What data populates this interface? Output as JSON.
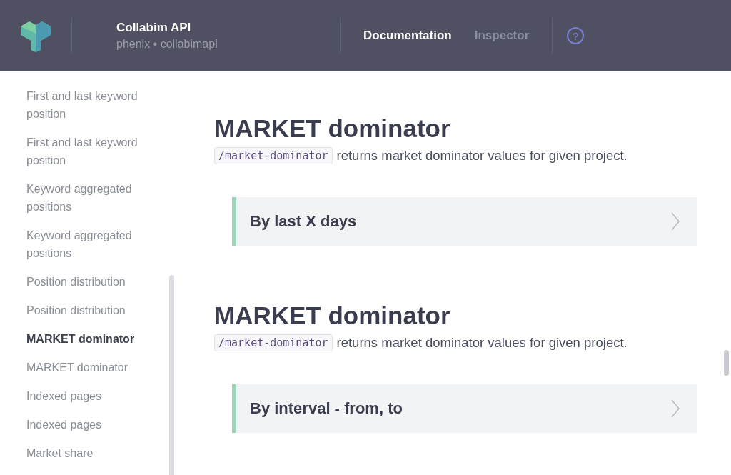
{
  "header": {
    "title": "Collabim API",
    "subtitle": "phenix • collabimapi",
    "nav": [
      {
        "label": "Documentation",
        "selected": true
      },
      {
        "label": "Inspector",
        "selected": false
      }
    ],
    "help": "?"
  },
  "sidebar": {
    "items": [
      {
        "label": "First and last keyword position",
        "selected": false
      },
      {
        "label": "First and last keyword position",
        "selected": false
      },
      {
        "label": "Keyword aggregated positions",
        "selected": false
      },
      {
        "label": "Keyword aggregated positions",
        "selected": false
      },
      {
        "label": "Position distribution",
        "selected": false
      },
      {
        "label": "Position distribution",
        "selected": false
      },
      {
        "label": "MARKET dominator",
        "selected": true
      },
      {
        "label": "MARKET dominator",
        "selected": false
      },
      {
        "label": "Indexed pages",
        "selected": false
      },
      {
        "label": "Indexed pages",
        "selected": false
      },
      {
        "label": "Market share",
        "selected": false
      }
    ]
  },
  "sections": [
    {
      "title": "MARKET dominator",
      "endpoint": "/market-dominator",
      "description": "returns market dominator values for given project.",
      "operations": [
        {
          "label": "By last X days"
        }
      ]
    },
    {
      "title": "MARKET dominator",
      "endpoint": "/market-dominator",
      "description": "returns market dominator values for given project.",
      "operations": [
        {
          "label": "By interval - from, to"
        }
      ]
    }
  ]
}
